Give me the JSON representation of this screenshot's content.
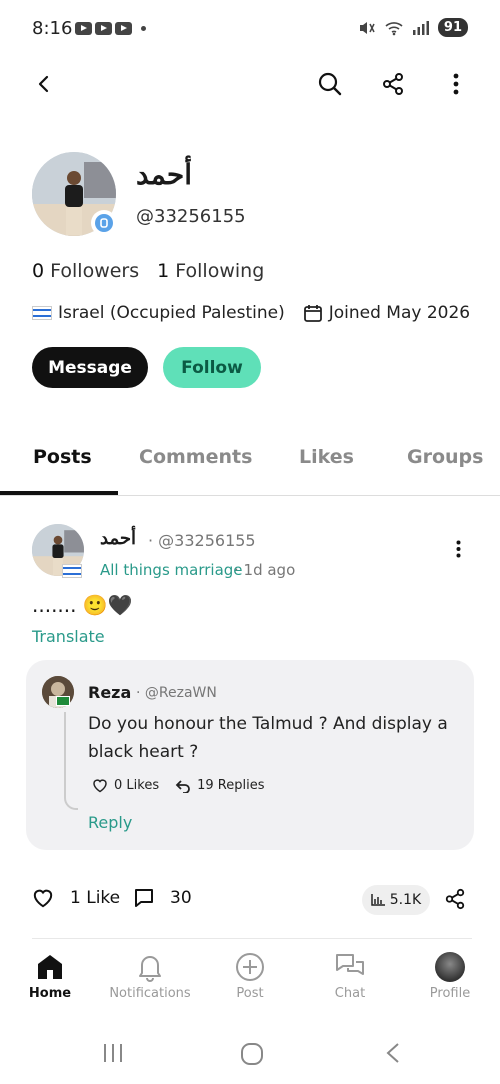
{
  "status_bar": {
    "time": "8:16",
    "battery": "91"
  },
  "profile": {
    "name": "أحمد",
    "handle": "@33256155",
    "followers_count": "0",
    "followers_label": "Followers",
    "following_count": "1",
    "following_label": "Following",
    "location": "Israel (Occupied Palestine)",
    "joined": "Joined May 2026",
    "message_label": "Message",
    "follow_label": "Follow"
  },
  "tabs": [
    "Posts",
    "Comments",
    "Likes",
    "Groups"
  ],
  "post": {
    "author_name": "أحمد",
    "author_handle": "· @33256155",
    "group": "All things marriage",
    "time": "· 1d ago",
    "body": "....... 🙂🖤",
    "translate_label": "Translate",
    "reply": {
      "author_name": "Reza",
      "author_handle": "· @RezaWN",
      "text": "Do you honour the Talmud ? And display a black heart ?",
      "likes": "0 Likes",
      "replies": "19 Replies",
      "reply_label": "Reply"
    },
    "likes": "1 Like",
    "comments": "30",
    "views": "5.1K"
  },
  "bottom_nav": [
    {
      "label": "Home",
      "icon": "home-icon",
      "active": true
    },
    {
      "label": "Notifications",
      "icon": "bell-icon"
    },
    {
      "label": "Post",
      "icon": "plus-circle-icon"
    },
    {
      "label": "Chat",
      "icon": "chat-icon"
    },
    {
      "label": "Profile",
      "icon": "profile-avatar"
    }
  ],
  "colors": {
    "accent": "#5fe0b8",
    "link": "#2a9a8a",
    "dark": "#111111"
  }
}
